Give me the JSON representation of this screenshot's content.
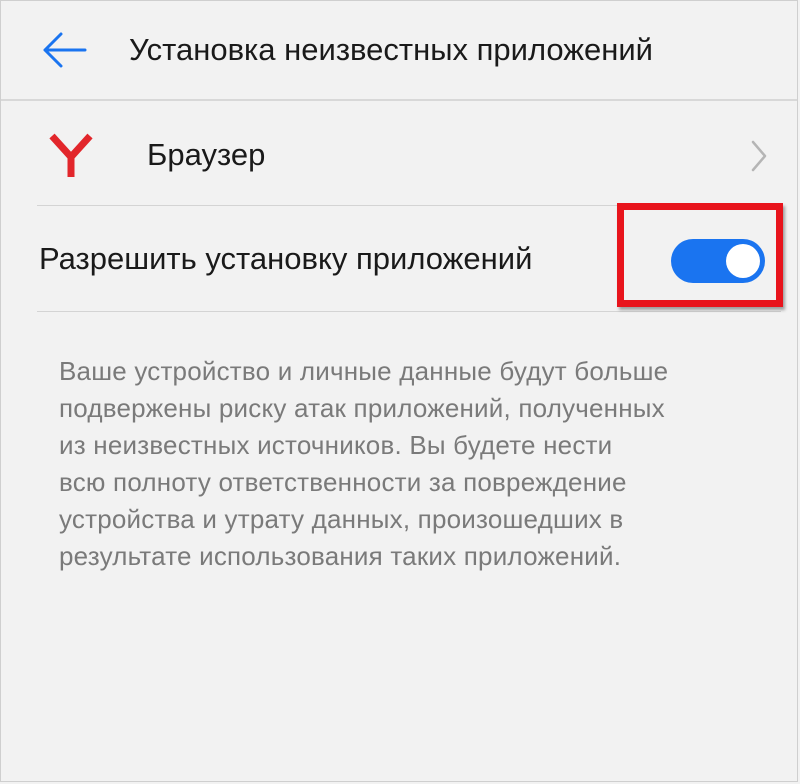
{
  "header": {
    "back_icon": "arrow-left-icon",
    "title": "Установка неизвестных приложений"
  },
  "app_row": {
    "icon": "yandex-browser-icon",
    "name": "Браузер",
    "chevron_icon": "chevron-right-icon"
  },
  "permission": {
    "label": "Разрешить установку приложений",
    "enabled": true
  },
  "warning": {
    "lines": [
      "Ваше устройство и личные данные будут больше",
      "подвержены риску атак приложений, полученных",
      "из неизвестных источников. Вы будете нести",
      "всю полноту ответственности за повреждение",
      "устройства и утрату данных, произошедших в",
      "результате использования таких приложений."
    ]
  },
  "colors": {
    "accent": "#1a74f0",
    "highlight": "#e8141c",
    "logo": "#e2262b",
    "text": "#1a1a1a",
    "secondary_text": "#7a7a7a",
    "background": "#f2f2f2"
  }
}
